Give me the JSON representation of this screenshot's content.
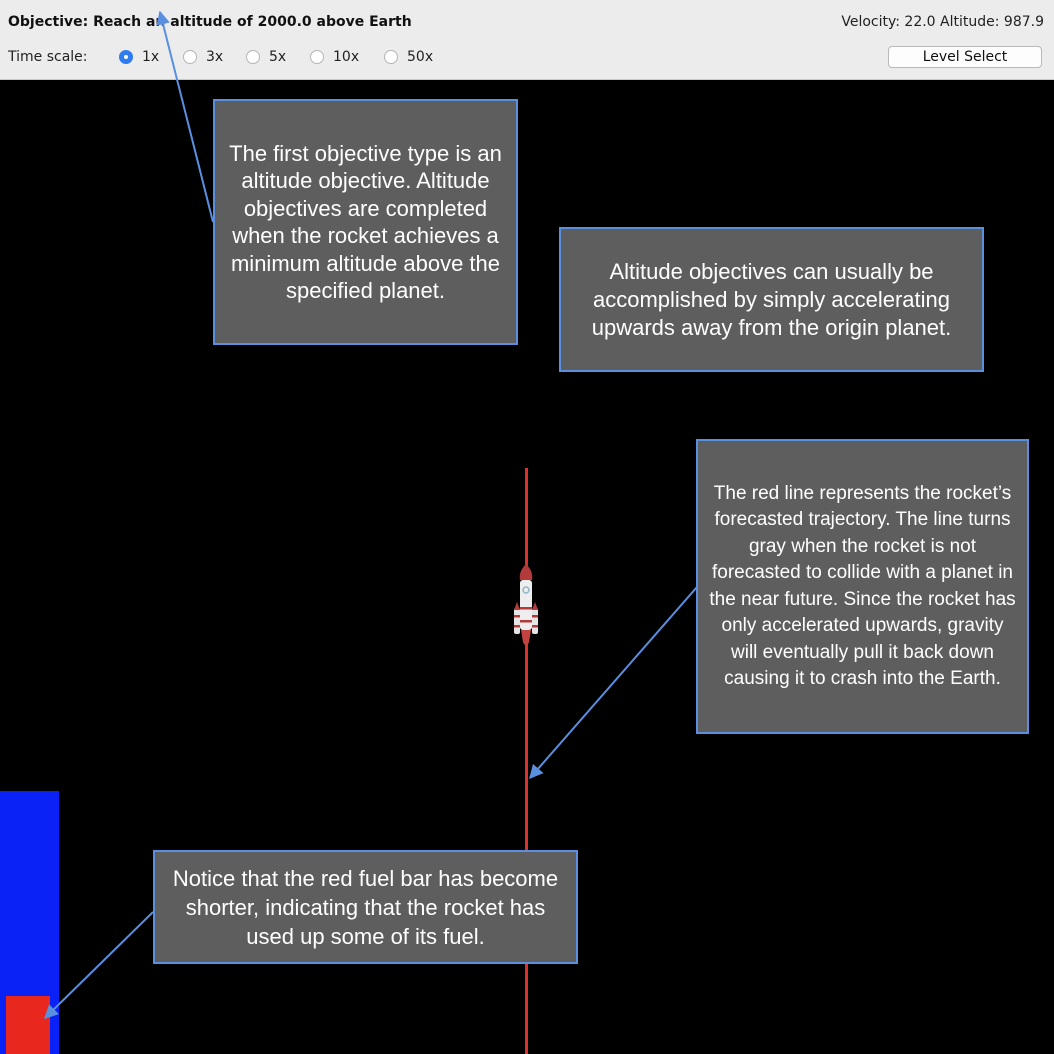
{
  "window": {
    "objective": "Objective: Reach an altitude of 2000.0 above Earth",
    "status": "Velocity: 22.0 Altitude: 987.9"
  },
  "time_scale": {
    "label": "Time scale:",
    "options": [
      {
        "label": "1x",
        "selected": true
      },
      {
        "label": "3x",
        "selected": false
      },
      {
        "label": "5x",
        "selected": false
      },
      {
        "label": "10x",
        "selected": false
      },
      {
        "label": "50x",
        "selected": false
      }
    ]
  },
  "level_select_label": "Level Select",
  "game": {
    "fuel_fraction": 0.22,
    "trajectory_color": "#e0302a",
    "fuel_color": "#e8281f",
    "fuel_container_color": "#0a22f5",
    "rocket_icon": "rocket-icon"
  },
  "annotations": {
    "note1": "The first objective type is an altitude objective. Altitude objectives are completed when the rocket achieves a minimum altitude above the specified planet.",
    "note2": "Altitude objectives can usually be accomplished by simply accelerating upwards away from the origin planet.",
    "note3": "The red line represents the rocket’s forecasted trajectory. The line turns gray when the rocket is not forecasted to collide with a planet in the near future. Since the rocket has only accelerated upwards, gravity will eventually pull it back down causing it to crash into the Earth.",
    "note4": "Notice that the red fuel bar has become shorter, indicating that the rocket has used up some of its fuel."
  }
}
